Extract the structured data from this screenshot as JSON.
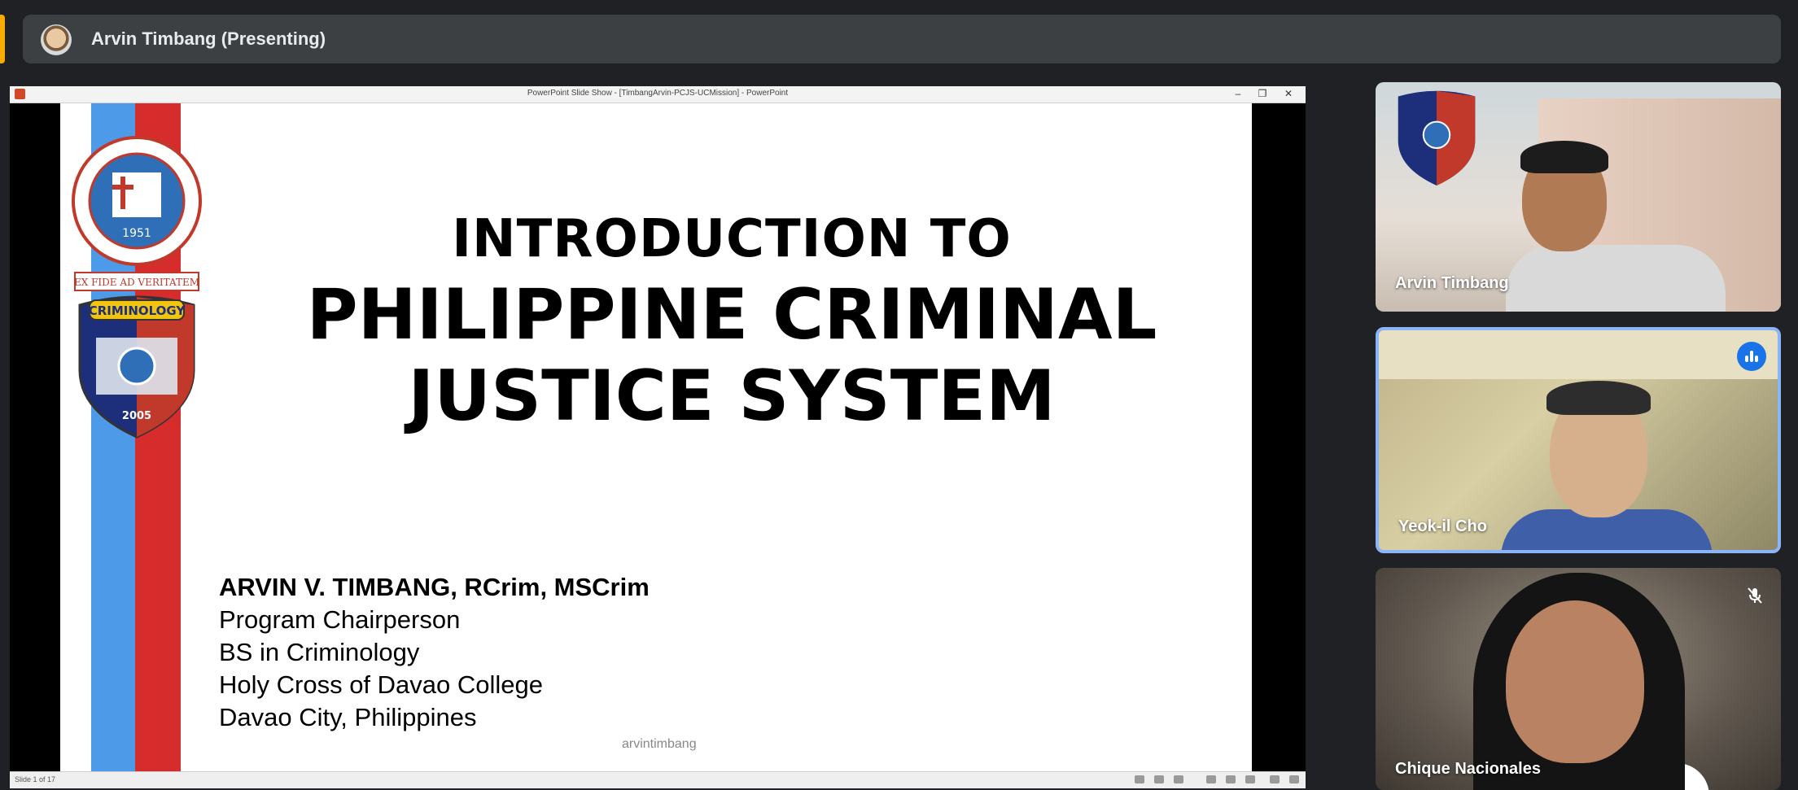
{
  "meeting": {
    "presenter_label": "Arvin Timbang (Presenting)"
  },
  "powerpoint": {
    "window_title": "PowerPoint Slide Show - [TimbangArvin-PCJS-UCMission] - PowerPoint",
    "slide_indicator": "Slide 1 of 17",
    "slide": {
      "title_line1": "INTRODUCTION TO",
      "title_line2": "PHILIPPINE CRIMINAL",
      "title_line3": "JUSTICE SYSTEM",
      "author_name": "ARVIN V. TIMBANG, RCrim, MSCrim",
      "author_role": "Program Chairperson",
      "author_program": "BS in Criminology",
      "author_school": "Holy Cross of Davao College",
      "author_city": "Davao City, Philippines",
      "watermark": "arvintimbang",
      "seal_motto": "EX FIDE AD VERITATEM",
      "seal_year": "1951",
      "badge_text": "CRIMINOLOGY",
      "badge_year": "2005"
    }
  },
  "participants": [
    {
      "name": "Arvin Timbang",
      "speaking": false,
      "muted": false
    },
    {
      "name": "Yeok-il Cho",
      "speaking": true,
      "muted": false
    },
    {
      "name": "Chique Nacionales",
      "speaking": false,
      "muted": true
    }
  ],
  "colors": {
    "background": "#202124",
    "topbar": "#3c4043",
    "accent_yellow": "#f9ab00",
    "speaking_border": "#8ab4f8",
    "speaking_badge": "#1a73e8",
    "stripe_blue": "#4d9be8",
    "stripe_red": "#d62c2c"
  }
}
